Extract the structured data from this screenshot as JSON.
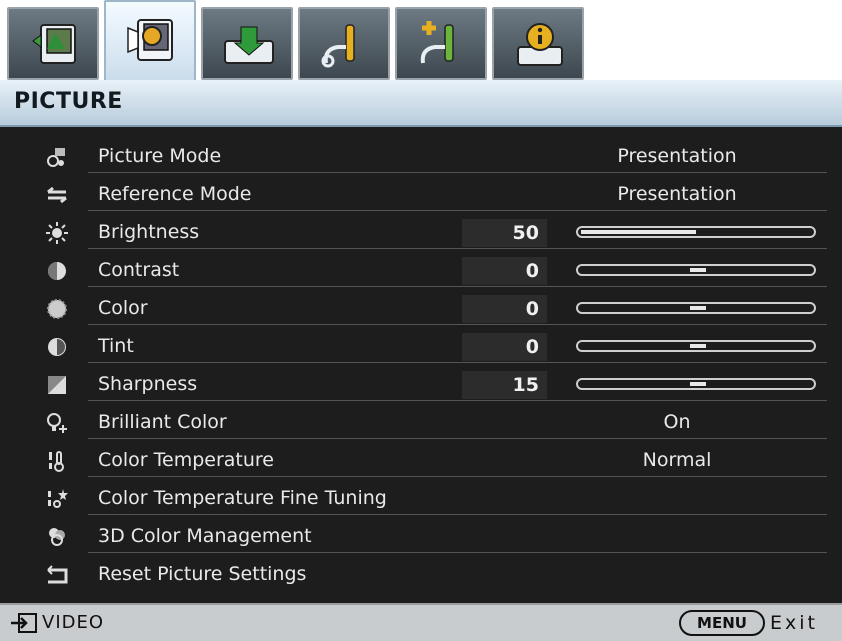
{
  "tabs": [
    {
      "icon": "display-icon",
      "active": false
    },
    {
      "icon": "picture-icon",
      "active": true
    },
    {
      "icon": "source-icon",
      "active": false
    },
    {
      "icon": "system-setup-basic-icon",
      "active": false
    },
    {
      "icon": "system-setup-advanced-icon",
      "active": false
    },
    {
      "icon": "information-icon",
      "active": false
    }
  ],
  "menu": {
    "title": "PICTURE"
  },
  "items": [
    {
      "label": "Picture Mode",
      "value": "Presentation",
      "icon": "picture-mode-icon"
    },
    {
      "label": "Reference Mode",
      "value": "Presentation",
      "icon": "reference-mode-icon"
    },
    {
      "label": "Brightness",
      "value": "50",
      "icon": "brightness-icon",
      "slider_fraction": 0.5
    },
    {
      "label": "Contrast",
      "value": "0",
      "icon": "contrast-icon",
      "slider_fraction": 0.5
    },
    {
      "label": "Color",
      "value": "0",
      "icon": "color-icon",
      "slider_fraction": 0.5
    },
    {
      "label": "Tint",
      "value": "0",
      "icon": "tint-icon",
      "slider_fraction": 0.5
    },
    {
      "label": "Sharpness",
      "value": "15",
      "icon": "sharpness-icon",
      "slider_fraction": 0.5
    },
    {
      "label": "Brilliant Color",
      "value": "On",
      "icon": "brilliant-color-icon"
    },
    {
      "label": "Color Temperature",
      "value": "Normal",
      "icon": "color-temperature-icon"
    },
    {
      "label": "Color Temperature Fine Tuning",
      "icon": "color-temperature-tuning-icon"
    },
    {
      "label": "3D Color Management",
      "icon": "3d-color-management-icon"
    },
    {
      "label": "Reset Picture Settings",
      "icon": "reset-icon"
    }
  ],
  "footer": {
    "source": "VIDEO",
    "menu_key": "MENU",
    "exit": "Exit"
  },
  "colors": {
    "background": "#1d1d1d",
    "title_bar": "#c9dbe9",
    "footer": "#c9ccce",
    "text": "#e9e9e9"
  }
}
